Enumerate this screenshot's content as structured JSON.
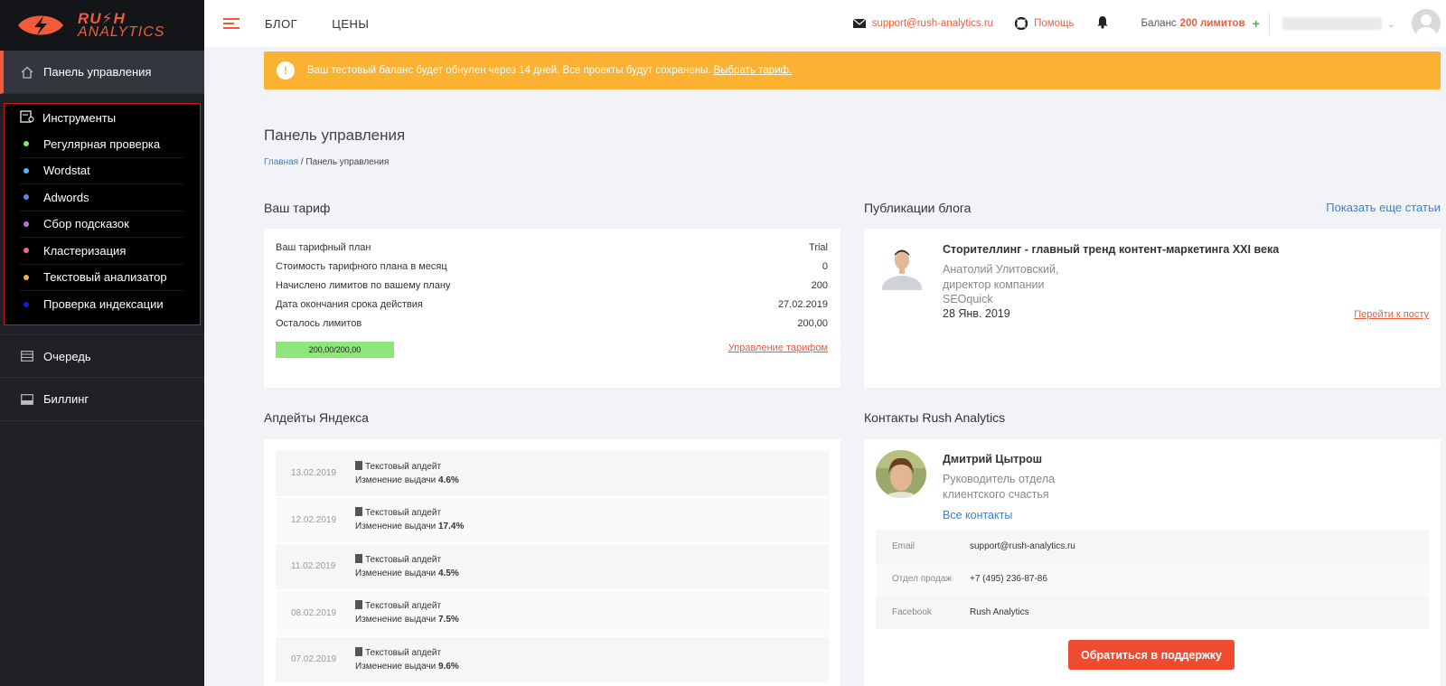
{
  "logo": {
    "line1": "RU⚡H",
    "line2": "ANALYTICS"
  },
  "sidebar": {
    "dashboard": "Панель управления",
    "tools_title": "Инструменты",
    "tools": [
      {
        "label": "Регулярная проверка",
        "color": "#8ce07a"
      },
      {
        "label": "Wordstat",
        "color": "#5ab4e5"
      },
      {
        "label": "Adwords",
        "color": "#5a8be5"
      },
      {
        "label": "Сбор подсказок",
        "color": "#c06ee0"
      },
      {
        "label": "Кластеризация",
        "color": "#f06a8a"
      },
      {
        "label": "Текстовый анализатор",
        "color": "#f0b040"
      },
      {
        "label": "Проверка индексации",
        "color": "#1a1adf"
      }
    ],
    "queue": "Очередь",
    "billing": "Биллинг"
  },
  "topbar": {
    "blog": "БЛОГ",
    "prices": "ЦЕНЫ",
    "email": "support@rush-analytics.ru",
    "help": "Помощь",
    "balance_label": "Баланс",
    "balance_value": "200 лимитов",
    "plus": "+"
  },
  "alert": {
    "text": "Ваш тестовый баланс будет обнулен через 14 дней. Все проекты будут сохранены.",
    "link": "Выбрать тариф."
  },
  "page": {
    "title": "Панель управления",
    "crumb_home": "Главная",
    "crumb_current": " / Панель управления"
  },
  "tariff": {
    "title": "Ваш тариф",
    "rows": [
      {
        "label": "Ваш тарифный план",
        "value": "Trial"
      },
      {
        "label": "Стоимость тарифного плана в месяц",
        "value": "0"
      },
      {
        "label": "Начислено лимитов по вашему плану",
        "value": "200"
      },
      {
        "label": "Дата окончания срока действия",
        "value": "27.02.2019"
      },
      {
        "label": "Осталось лимитов",
        "value": "200,00"
      }
    ],
    "progress_label": "200,00/200,00",
    "progress_fraction": 1.0,
    "manage_link": "Управление тарифом"
  },
  "blog": {
    "title": "Публикации блога",
    "more": "Показать еще статьи",
    "post_title": "Сторителлинг - главный тренд контент-маркетинга XXI века",
    "author": "Анатолий Улитовский,",
    "position": "директор компании",
    "company": "SEOquick",
    "date": "28 Янв. 2019",
    "go_link": "Перейти к посту"
  },
  "updates": {
    "title": "Апдейты Яндекса",
    "items": [
      {
        "date": "13.02.2019",
        "type": "Текстовый апдейт",
        "change_label": "Изменение выдачи",
        "change": "4.6%"
      },
      {
        "date": "12.02.2019",
        "type": "Текстовый апдейт",
        "change_label": "Изменение выдачи",
        "change": "17.4%"
      },
      {
        "date": "11.02.2019",
        "type": "Текстовый апдейт",
        "change_label": "Изменение выдачи",
        "change": "4.5%"
      },
      {
        "date": "08.02.2019",
        "type": "Текстовый апдейт",
        "change_label": "Изменение выдачи",
        "change": "7.5%"
      },
      {
        "date": "07.02.2019",
        "type": "Текстовый апдейт",
        "change_label": "Изменение выдачи",
        "change": "9.6%"
      }
    ]
  },
  "contacts": {
    "title": "Контакты Rush Analytics",
    "name": "Дмитрий Цытрош",
    "role_line1": "Руководитель отдела",
    "role_line2": "клиентского счастья",
    "all_link": "Все контакты",
    "rows": [
      {
        "key": "Email",
        "value": "support@rush-analytics.ru"
      },
      {
        "key": "Отдел продаж",
        "value": "+7 (495) 236-87-86"
      },
      {
        "key": "Facebook",
        "value": "Rush Analytics"
      }
    ],
    "support_button": "Обратиться в поддержку"
  }
}
